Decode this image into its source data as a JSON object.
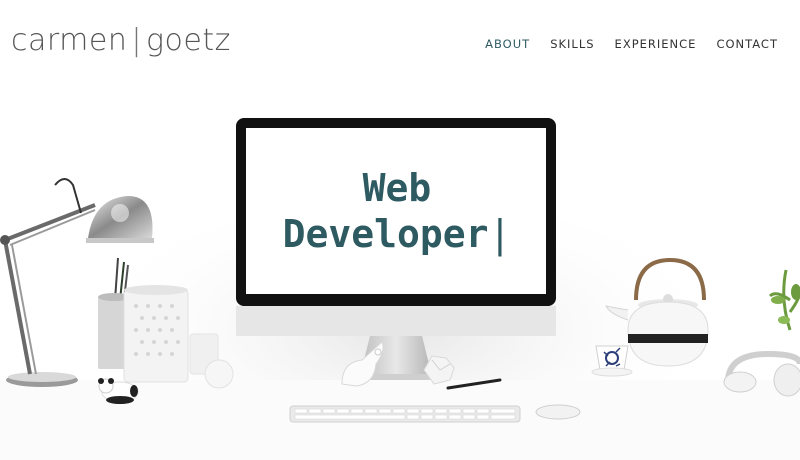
{
  "header": {
    "logo_first": "carmen",
    "logo_separator": "|",
    "logo_last": "goetz"
  },
  "nav": {
    "items": [
      {
        "label": "ABOUT",
        "active": true
      },
      {
        "label": "SKILLS",
        "active": false
      },
      {
        "label": "EXPERIENCE",
        "active": false
      },
      {
        "label": "CONTACT",
        "active": false
      }
    ]
  },
  "hero": {
    "line1": "Web",
    "line2": "Developer",
    "cursor": "|"
  },
  "colors": {
    "accent": "#2e5a62",
    "text": "#333333",
    "logo": "#555555"
  },
  "icons": [
    "desk-lamp-icon",
    "pencil-cup-icon",
    "panda-figurine-icon",
    "monitor-icon",
    "bird-figurine-icon",
    "keyboard-icon",
    "mouse-icon",
    "teapot-icon",
    "teacup-icon",
    "headphones-icon",
    "plant-icon"
  ]
}
